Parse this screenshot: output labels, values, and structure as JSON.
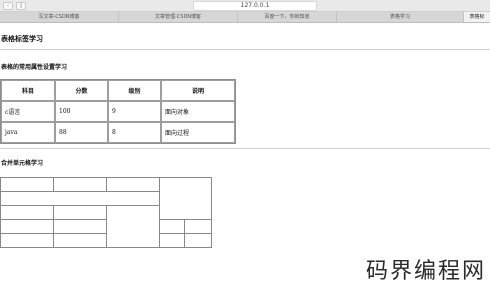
{
  "browser": {
    "url": "127.0.0.1",
    "back_icon": "chevron-left-icon",
    "sidebar_icon": "sidebar-icon",
    "tabs": [
      {
        "label": "写文章-CSDN博客",
        "active": false
      },
      {
        "label": "文章管理-CSDN博客",
        "active": false
      },
      {
        "label": "百度一下，你就知道",
        "active": false
      },
      {
        "label": "表格学习",
        "active": false
      },
      {
        "label": "表格标",
        "active": true
      }
    ]
  },
  "page": {
    "title": "表格标签学习",
    "section1_title": "表格的常用属性设置学习",
    "section2_title": "合并单元格学习"
  },
  "attr_table": {
    "headers": [
      "科目",
      "分数",
      "级别",
      "说明"
    ],
    "rows": [
      [
        "c语言",
        "100",
        "9",
        "面向对象"
      ],
      [
        "java",
        "88",
        "8",
        "面向过程"
      ]
    ]
  },
  "watermark": "码界编程网"
}
